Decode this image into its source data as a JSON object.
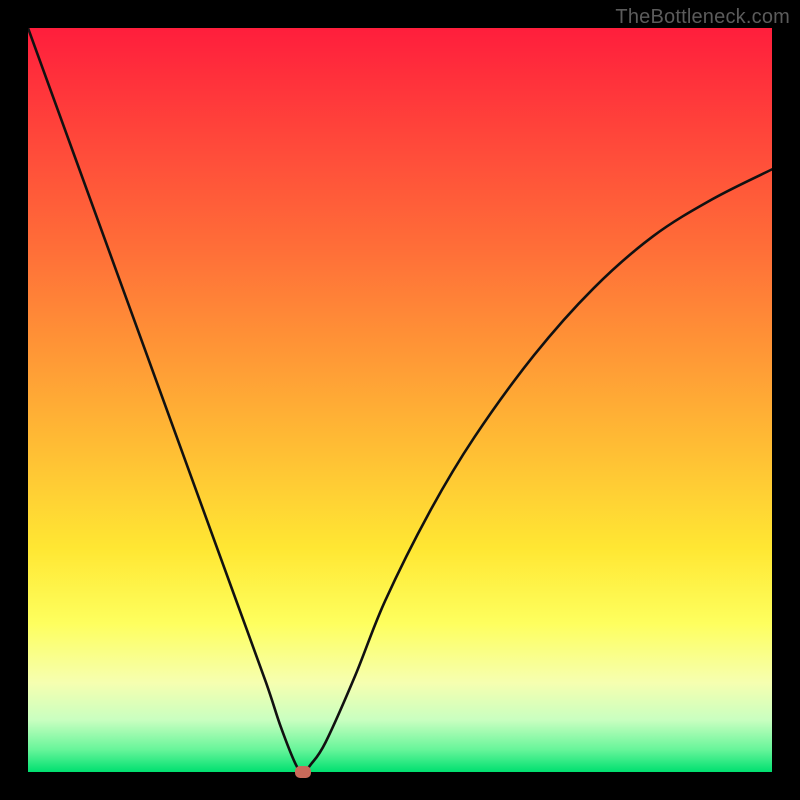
{
  "watermark": "TheBottleneck.com",
  "colors": {
    "background": "#000000",
    "gradient_top": "#ff1e3c",
    "gradient_bottom": "#00e070",
    "curve": "#111111",
    "marker": "#c96a5a",
    "watermark_text": "#5b5b5b"
  },
  "chart_data": {
    "type": "line",
    "title": "",
    "xlabel": "",
    "ylabel": "",
    "xlim": [
      0,
      100
    ],
    "ylim": [
      0,
      100
    ],
    "grid": false,
    "legend": false,
    "series": [
      {
        "name": "bottleneck-curve",
        "x": [
          0,
          4,
          8,
          12,
          16,
          20,
          24,
          28,
          32,
          34,
          36,
          37,
          38,
          40,
          44,
          48,
          54,
          60,
          68,
          76,
          84,
          92,
          100
        ],
        "y": [
          100,
          89,
          78,
          67,
          56,
          45,
          34,
          23,
          12,
          6,
          1,
          0,
          1,
          4,
          13,
          23,
          35,
          45,
          56,
          65,
          72,
          77,
          81
        ]
      }
    ],
    "marker": {
      "x": 37,
      "y": 0
    }
  }
}
